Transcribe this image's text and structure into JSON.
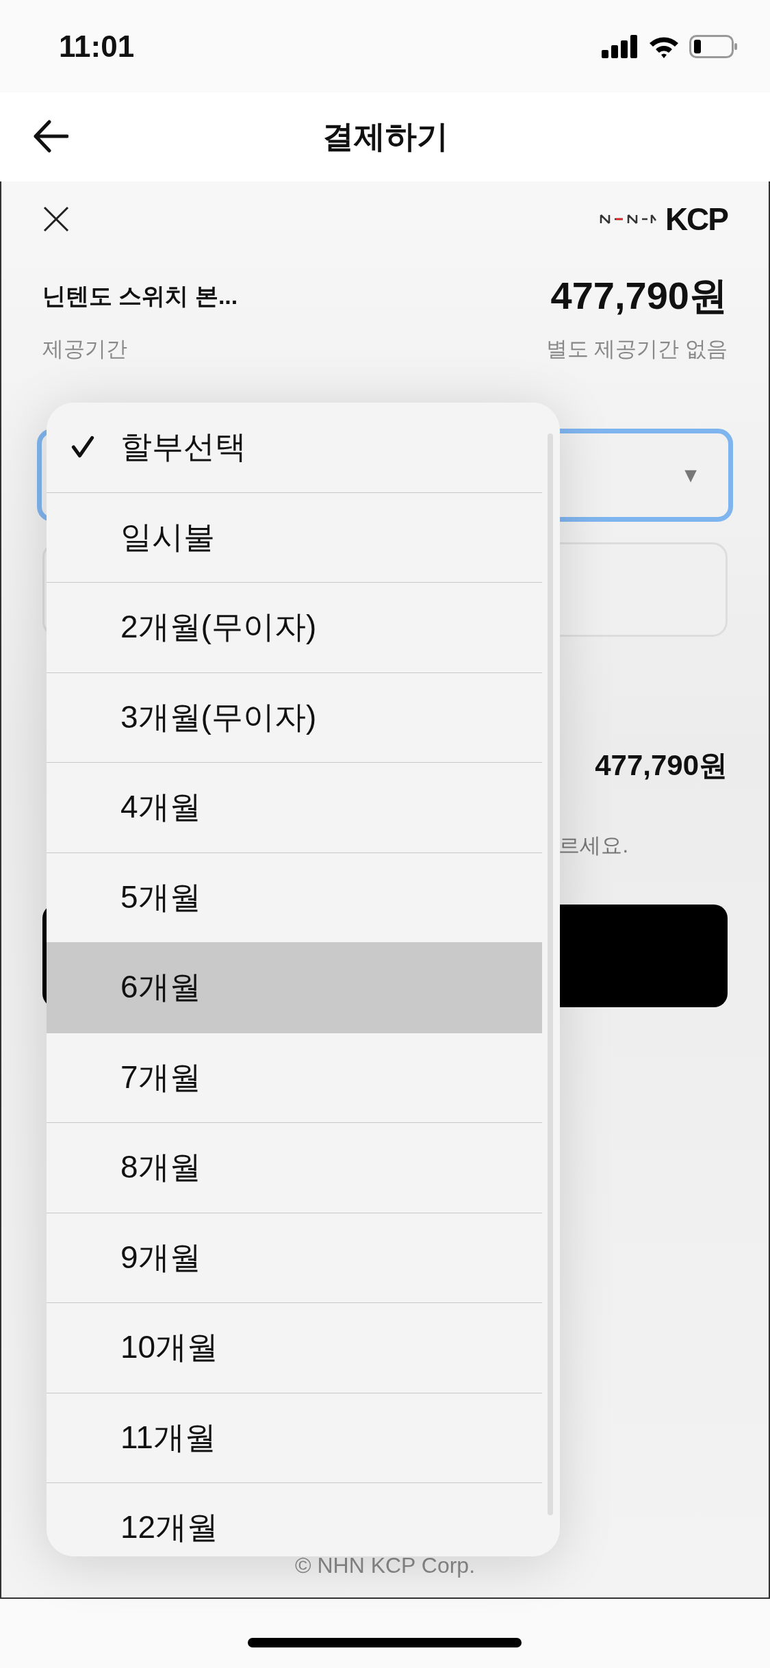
{
  "status_bar": {
    "time": "11:01"
  },
  "nav": {
    "title": "결제하기"
  },
  "payment": {
    "logo": "KCP",
    "product": "닌텐도 스위치 본...",
    "price": "477,790원",
    "period_label": "제공기간",
    "period_value": "별도 제공기간 없음",
    "total": "477,790원",
    "note": "르세요.",
    "footer": "© NHN KCP Corp."
  },
  "select": {
    "arrow": "▼"
  },
  "dropdown": {
    "options": [
      {
        "label": "할부선택",
        "checked": true,
        "highlighted": false
      },
      {
        "label": "일시불",
        "checked": false,
        "highlighted": false
      },
      {
        "label": "2개월(무이자)",
        "checked": false,
        "highlighted": false
      },
      {
        "label": "3개월(무이자)",
        "checked": false,
        "highlighted": false
      },
      {
        "label": "4개월",
        "checked": false,
        "highlighted": false
      },
      {
        "label": "5개월",
        "checked": false,
        "highlighted": false
      },
      {
        "label": "6개월",
        "checked": false,
        "highlighted": true
      },
      {
        "label": "7개월",
        "checked": false,
        "highlighted": false
      },
      {
        "label": "8개월",
        "checked": false,
        "highlighted": false
      },
      {
        "label": "9개월",
        "checked": false,
        "highlighted": false
      },
      {
        "label": "10개월",
        "checked": false,
        "highlighted": false
      },
      {
        "label": "11개월",
        "checked": false,
        "highlighted": false
      },
      {
        "label": "12개월",
        "checked": false,
        "highlighted": false
      }
    ]
  }
}
